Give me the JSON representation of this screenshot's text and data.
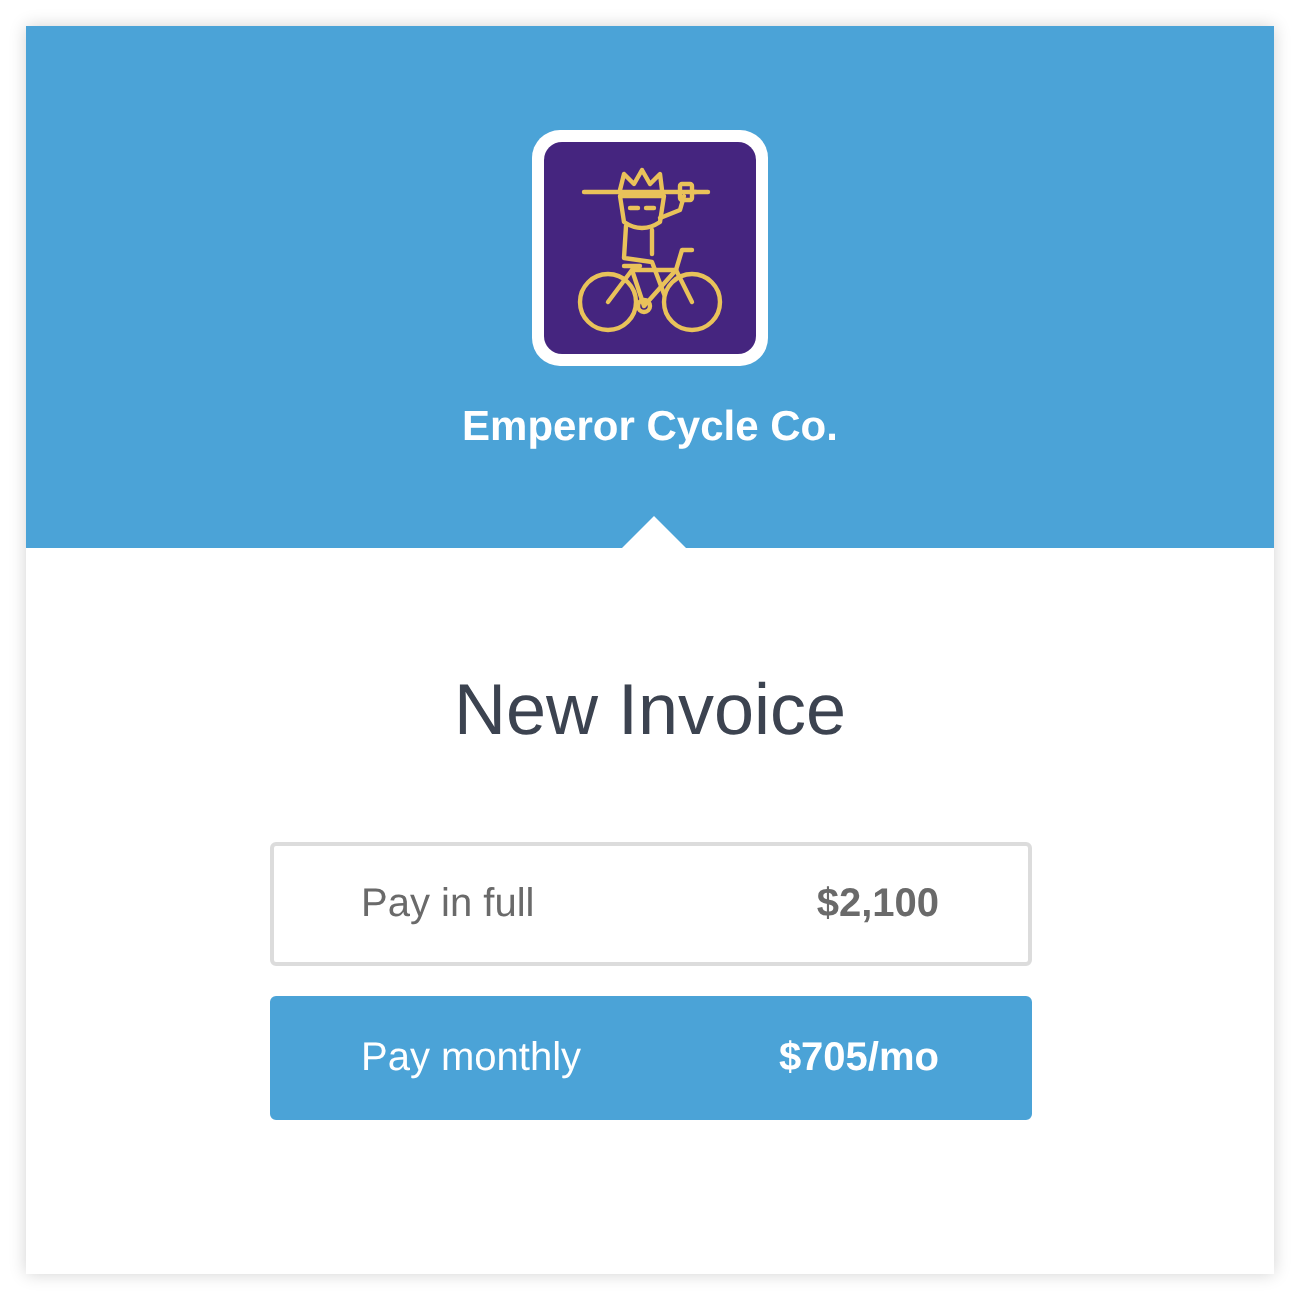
{
  "merchant": {
    "name": "Emperor Cycle Co."
  },
  "title": "New Invoice",
  "options": [
    {
      "label": "Pay in full",
      "amount": "$2,100",
      "selected": false
    },
    {
      "label": "Pay monthly",
      "amount": "$705/mo",
      "selected": true
    }
  ]
}
